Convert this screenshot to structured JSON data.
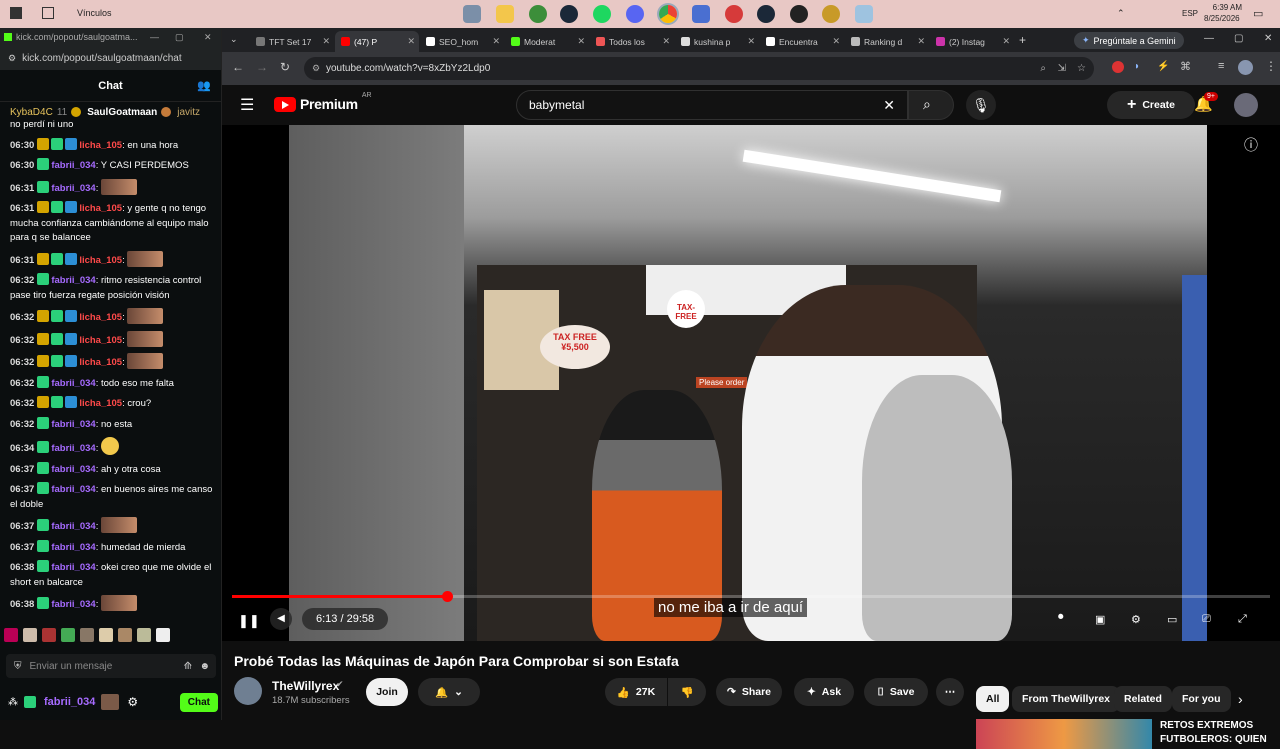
{
  "taskbar": {
    "folder_label": "Vínculos",
    "time": "6:39 AM",
    "date": "8/25/2026",
    "lang": "ESP"
  },
  "kick": {
    "titlebar": "kick.com/popout/saulgoatma...",
    "url": "kick.com/popout/saulgoatmaan/chat",
    "chat_title": "Chat",
    "pinned": {
      "user1": "KybaD4C",
      "count1": "11",
      "user2": "SaulGoatmaan",
      "count2": "1",
      "user3": "javitz"
    },
    "first_line": "no perdí ni uno",
    "messages": [
      {
        "time": "06:30",
        "user": "licha_105",
        "color": "red",
        "badges": 3,
        "text": "en una hora"
      },
      {
        "time": "06:30",
        "user": "fabrii_034",
        "color": "purple",
        "badges": 1,
        "text": "Y CASI PERDEMOS"
      },
      {
        "time": "06:31",
        "user": "fabrii_034",
        "color": "purple",
        "badges": 1,
        "text": "",
        "emote": true
      },
      {
        "time": "06:31",
        "user": "licha_105",
        "color": "red",
        "badges": 3,
        "text": "y gente q no tengo mucha confianza cambiándome al equipo malo para q se balancee"
      },
      {
        "time": "06:31",
        "user": "licha_105",
        "color": "red",
        "badges": 3,
        "text": "",
        "emote": true
      },
      {
        "time": "06:32",
        "user": "fabrii_034",
        "color": "purple",
        "badges": 1,
        "text": "ritmo resistencia control pase tiro fuerza regate posición visión"
      },
      {
        "time": "06:32",
        "user": "licha_105",
        "color": "red",
        "badges": 3,
        "text": "",
        "emote": true
      },
      {
        "time": "06:32",
        "user": "licha_105",
        "color": "red",
        "badges": 3,
        "text": "",
        "emote": true
      },
      {
        "time": "06:32",
        "user": "licha_105",
        "color": "red",
        "badges": 3,
        "text": "",
        "emote": true
      },
      {
        "time": "06:32",
        "user": "fabrii_034",
        "color": "purple",
        "badges": 1,
        "text": "todo eso me falta"
      },
      {
        "time": "06:32",
        "user": "licha_105",
        "color": "red",
        "badges": 3,
        "text": "crou?"
      },
      {
        "time": "06:32",
        "user": "fabrii_034",
        "color": "purple",
        "badges": 1,
        "text": "no esta"
      },
      {
        "time": "06:34",
        "user": "fabrii_034",
        "color": "purple",
        "badges": 1,
        "text": "",
        "smile": true
      },
      {
        "time": "06:37",
        "user": "fabrii_034",
        "color": "purple",
        "badges": 1,
        "text": "ah y otra cosa"
      },
      {
        "time": "06:37",
        "user": "fabrii_034",
        "color": "purple",
        "badges": 1,
        "text": "en buenos aires me canso el doble"
      },
      {
        "time": "06:37",
        "user": "fabrii_034",
        "color": "purple",
        "badges": 1,
        "text": "",
        "emote": true
      },
      {
        "time": "06:37",
        "user": "fabrii_034",
        "color": "purple",
        "badges": 1,
        "text": "humedad de mierda"
      },
      {
        "time": "06:38",
        "user": "fabrii_034",
        "color": "purple",
        "badges": 1,
        "text": "okei creo que me olvide el short en balcarce"
      },
      {
        "time": "06:38",
        "user": "fabrii_034",
        "color": "purple",
        "badges": 1,
        "text": "",
        "emote": true
      }
    ],
    "input_placeholder": "Enviar un mensaje",
    "footer_user": "fabrii_034",
    "chat_button": "Chat"
  },
  "chrome": {
    "tabs": [
      "TFT Set 17",
      "(47) P",
      "SEO_hom",
      "Moderat",
      "Todos los",
      "kushina p",
      "Encuentra",
      "Ranking d",
      "(2) Instag"
    ],
    "gemini": "Pregúntale a Gemini",
    "url": "youtube.com/watch?v=8xZbYz2Ldp0"
  },
  "youtube": {
    "logo": "Premium",
    "region": "AR",
    "search_value": "babymetal",
    "create_label": "Create",
    "notif_count": "9+",
    "time_current": "6:13",
    "time_total": "29:58",
    "time_display": "6:13 / 29:58",
    "progress": 0.207,
    "subtitle": "no me iba a ir de aquí",
    "video_title": "Probé Todas las Máquinas de Japón Para Comprobar si son Estafa",
    "channel": "TheWillyrex",
    "subscribers": "18.7M subscribers",
    "join": "Join",
    "likes": "27K",
    "share": "Share",
    "ask": "Ask",
    "save": "Save",
    "chips": [
      "All",
      "From TheWillyrex",
      "Related",
      "For you"
    ],
    "rec_title_1": "RETOS EXTREMOS",
    "rec_title_2": "FUTBOLEROS: QUIEN",
    "scene": {
      "tax_free": "TAX FREE",
      "price": "¥5,500",
      "tax_free_sign": "TAX-FREE",
      "please_order": "Please order"
    }
  }
}
